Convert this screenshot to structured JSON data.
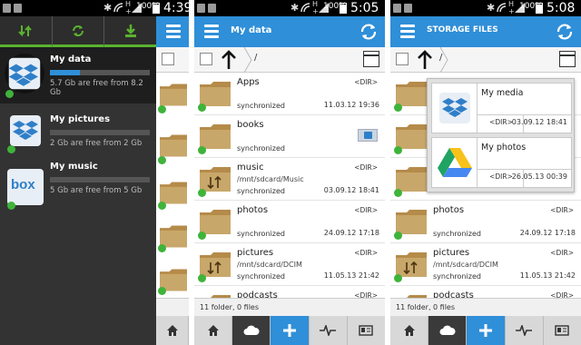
{
  "panel1": {
    "status": {
      "battery": "100%",
      "time": "4:39"
    },
    "accounts": [
      {
        "name": "My data",
        "info": "5.7 Gb are free from 8.2 Gb",
        "usage": 0.3,
        "icon": "dropbox-icon"
      },
      {
        "name": "My pictures",
        "info": "2 Gb are free from 2 Gb",
        "usage": 0.0,
        "icon": "dropbox-icon"
      },
      {
        "name": "My music",
        "info": "5 Gb are free from 5 Gb",
        "usage": 0.0,
        "icon": "box-icon"
      }
    ],
    "box_logo_text": "box"
  },
  "panel2": {
    "status": {
      "battery": "100%",
      "time": "5:05"
    },
    "title": "My data",
    "path": "/",
    "files": [
      {
        "name": "Apps",
        "path": "",
        "sync": "synchronized",
        "dir": "<DIR>",
        "date": "11.03.12 19:36",
        "special": false
      },
      {
        "name": "books",
        "path": "",
        "sync": "synchronized",
        "dir": "",
        "date": "",
        "special": true
      },
      {
        "name": "music",
        "path": "/mnt/sdcard/Music",
        "sync": "synchronized",
        "dir": "<DIR>",
        "date": "03.09.12 18:41",
        "special": false
      },
      {
        "name": "photos",
        "path": "",
        "sync": "synchronized",
        "dir": "<DIR>",
        "date": "24.09.12 17:18",
        "special": false
      },
      {
        "name": "pictures",
        "path": "/mnt/sdcard/DCIM",
        "sync": "synchronized",
        "dir": "<DIR>",
        "date": "11.05.13 21:42",
        "special": false
      },
      {
        "name": "podcasts",
        "path": "",
        "sync": "",
        "dir": "<DIR>",
        "date": "",
        "special": false
      }
    ],
    "footer": "11 folder, 0 files"
  },
  "panel3": {
    "status": {
      "battery": "100%",
      "time": "5:08"
    },
    "title": "STORAGE FILES",
    "path": "/",
    "files": [
      {
        "name": "",
        "path": "",
        "sync": "",
        "dir": "",
        "date": ""
      },
      {
        "name": "",
        "path": "",
        "sync": "",
        "dir": "",
        "date": ""
      },
      {
        "name": "",
        "path": "",
        "sync": "",
        "dir": "",
        "date": ""
      },
      {
        "name": "photos",
        "path": "",
        "sync": "synchronized",
        "dir": "<DIR>",
        "date": "24.09.12 17:18"
      },
      {
        "name": "pictures",
        "path": "/mnt/sdcard/DCIM",
        "sync": "synchronized",
        "dir": "<DIR>",
        "date": "11.05.13 21:42"
      },
      {
        "name": "podcasts",
        "path": "",
        "sync": "",
        "dir": "<DIR>",
        "date": ""
      }
    ],
    "footer": "11 folder, 0 files",
    "popup": [
      {
        "name": "My media",
        "dir": "<DIR>",
        "date": "03.09.12 18:41",
        "icon": "dropbox-icon"
      },
      {
        "name": "My photos",
        "dir": "<DIR>",
        "date": "26.05.13 00:39",
        "icon": "google-drive-icon"
      }
    ]
  },
  "colors": {
    "accent": "#2f8fd8",
    "sync_green": "#3fb33a",
    "folder": "#c8a76a"
  }
}
